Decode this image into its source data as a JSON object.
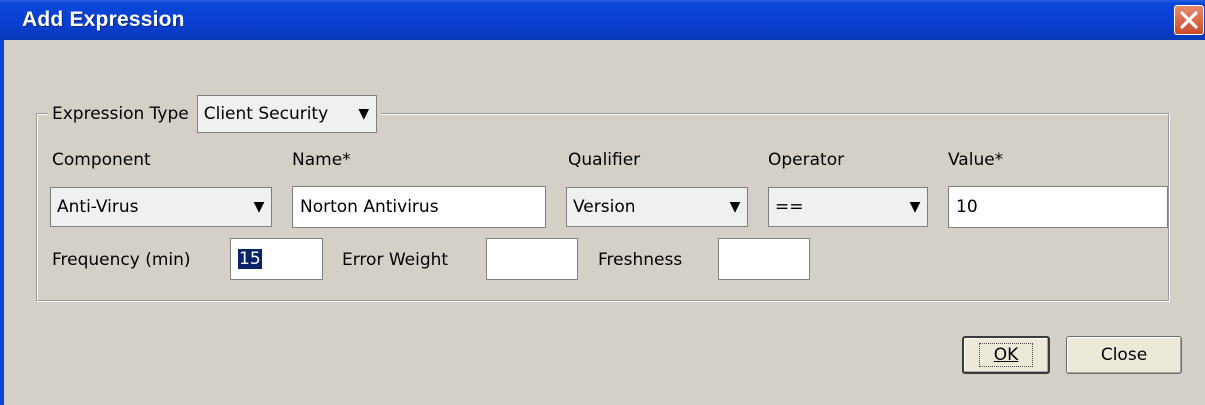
{
  "window": {
    "title": "Add Expression"
  },
  "expression_type": {
    "label": "Expression Type",
    "selected": "Client Security"
  },
  "component": {
    "label": "Component",
    "selected": "Anti-Virus"
  },
  "name": {
    "label": "Name*",
    "value": "Norton Antivirus"
  },
  "qualifier": {
    "label": "Qualifier",
    "selected": "Version"
  },
  "operator": {
    "label": "Operator",
    "selected": "=="
  },
  "value": {
    "label": "Value*",
    "value": "10"
  },
  "frequency": {
    "label": "Frequency (min)",
    "value": "15"
  },
  "error_weight": {
    "label": "Error Weight",
    "value": ""
  },
  "freshness": {
    "label": "Freshness",
    "value": ""
  },
  "buttons": {
    "ok": "OK",
    "close": "Close"
  },
  "icons": {
    "close": "close-icon",
    "dropdown": "triangle-down-icon"
  },
  "colors": {
    "titlebar": "#0a47d8",
    "dialog_bg": "#d4d0c8",
    "close_button": "#d9603f"
  }
}
